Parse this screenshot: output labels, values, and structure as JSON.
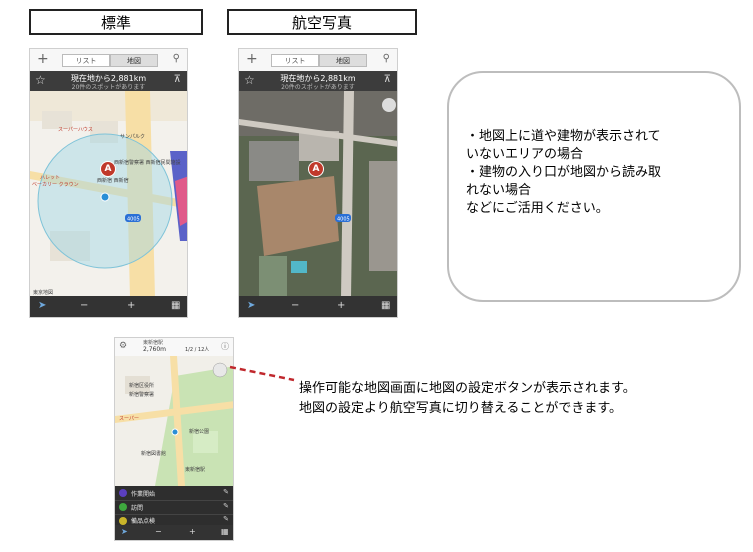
{
  "labels": {
    "standard": "標準",
    "aerial": "航空写真"
  },
  "phone": {
    "tab_list": "リスト",
    "tab_map": "地図",
    "distance_line": "現在地から2,881km",
    "spots_line": "20件のスポットがあります",
    "minus": "−",
    "plus": "+",
    "pin_label": "A",
    "plus_icon": "+",
    "search_icon": "search-icon",
    "star_icon": "star-icon",
    "nav_icon": "navigation-icon",
    "menu_icon": "menu-icon"
  },
  "map_labels": {
    "bldg1": "西新宿警察署 西新宿民間施設",
    "bldg2": "西新宿 西新宿",
    "place1": "サンパルク",
    "place2": "スーパーハウス",
    "place3": "ハレット",
    "place4": "ベーカリー クラウン",
    "corner": "東京地図",
    "route": "4005"
  },
  "callout": {
    "lines": [
      "・地図上に道や建物が表示されて",
      "いないエリアの場合",
      "・建物の入り口が地図から読み取",
      "れない場合",
      "などにご活用ください。"
    ]
  },
  "third_phone": {
    "header_name": "東新宿駅",
    "header_dist": "2,760m",
    "header_count": "1/2 / 12人",
    "map_labels": [
      "新宿区役所",
      "新宿警察署",
      "スーパー",
      "新宿公園",
      "新宿図書館",
      "東新宿駅"
    ],
    "list_items": [
      {
        "icon": "start-icon",
        "label": "作業開始"
      },
      {
        "icon": "visit-icon",
        "label": "訪問"
      },
      {
        "icon": "item-icon",
        "label": "備品点検"
      }
    ]
  },
  "note": {
    "line1": "操作可能な地図画面に地図の設定ボタンが表示されます。",
    "line2": "地図の設定より航空写真に切り替えることができます。"
  },
  "colors": {
    "pin": "#c0392b",
    "accuracy_circle": "#9fd6e6",
    "dashed_connector": "#c0282d",
    "map_bg": "#f3f1ec",
    "aerial_bg": "#5b6650"
  }
}
